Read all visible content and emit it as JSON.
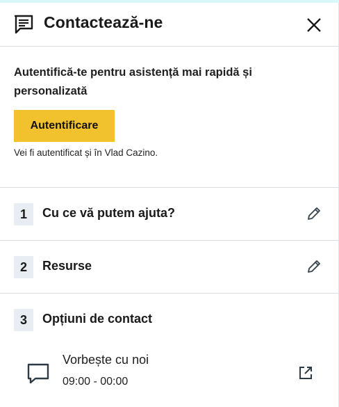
{
  "header": {
    "title": "Contactează-ne",
    "chat_icon": "chat-bubble-icon",
    "close_icon": "close-icon"
  },
  "auth": {
    "message": "Autentifică-te pentru asistență mai rapidă și personalizată",
    "button_label": "Autentificare",
    "note": "Vei fi autentificat și în Vlad Cazino.",
    "button_color": "#f2c12e"
  },
  "steps": [
    {
      "number": "1",
      "label": "Cu ce vă putem ajuta?",
      "icon": "pencil-icon"
    },
    {
      "number": "2",
      "label": "Resurse",
      "icon": "pencil-icon"
    },
    {
      "number": "3",
      "label": "Opțiuni de contact"
    }
  ],
  "contact_option": {
    "name": "Vorbește cu noi",
    "hours": "09:00 - 00:00",
    "icon": "chat-icon",
    "action_icon": "external-link-icon"
  }
}
